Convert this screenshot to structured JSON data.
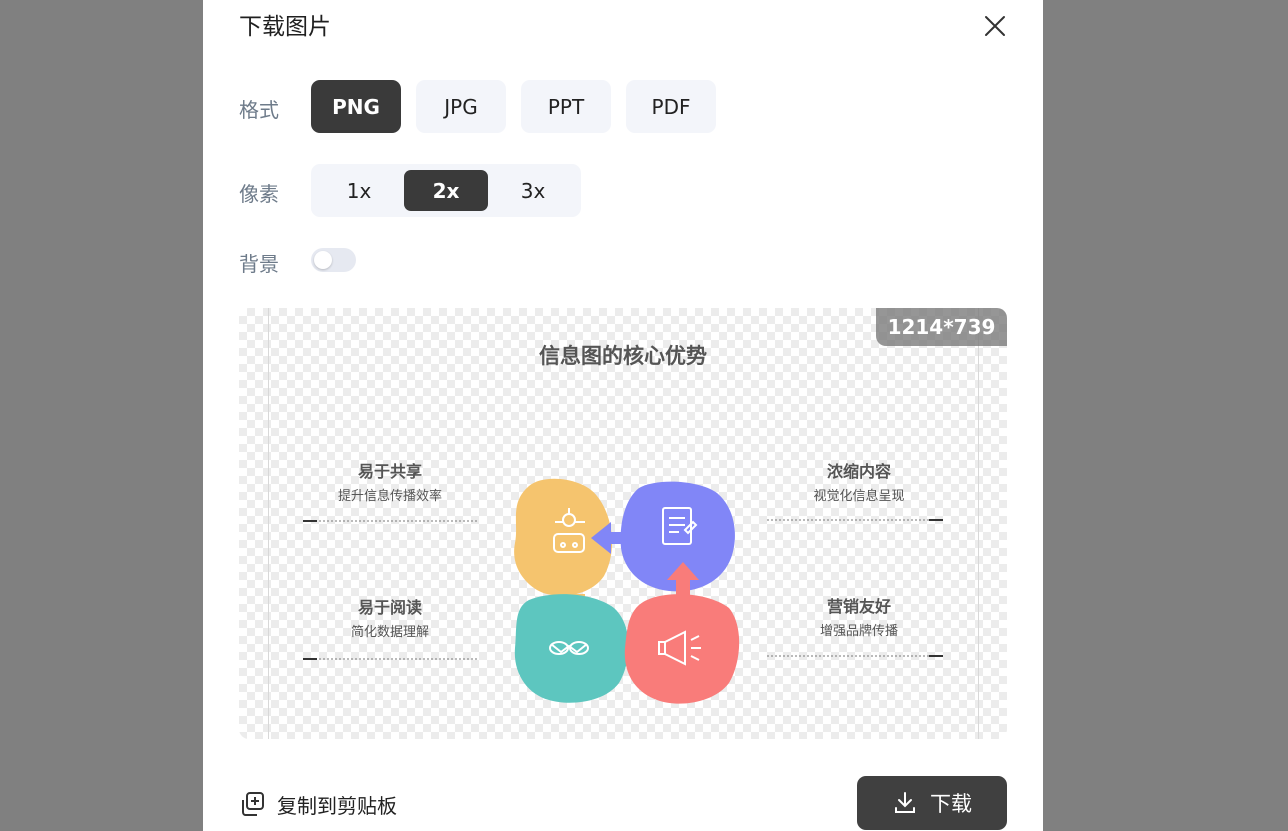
{
  "dialog": {
    "title": "下载图片",
    "format_label": "格式",
    "formats": [
      "PNG",
      "JPG",
      "PPT",
      "PDF"
    ],
    "selected_format": "PNG",
    "pixel_label": "像素",
    "pixel_options": [
      "1x",
      "2x",
      "3x"
    ],
    "selected_pixel": "2x",
    "background_label": "背景",
    "background_enabled": false,
    "copy_label": "复制到剪贴板",
    "download_label": "下载"
  },
  "preview": {
    "dimensions": "1214*739",
    "title": "信息图的核心优势",
    "blocks": [
      {
        "title": "易于共享",
        "subtitle": "提升信息传播效率"
      },
      {
        "title": "易于阅读",
        "subtitle": "简化数据理解"
      },
      {
        "title": "浓缩内容",
        "subtitle": "视觉化信息呈现"
      },
      {
        "title": "营销友好",
        "subtitle": "增强品牌传播"
      }
    ],
    "colors": {
      "yellow": "#F5C46E",
      "purple": "#8186F7",
      "teal": "#5DC6BF",
      "coral": "#F97C7A"
    }
  }
}
